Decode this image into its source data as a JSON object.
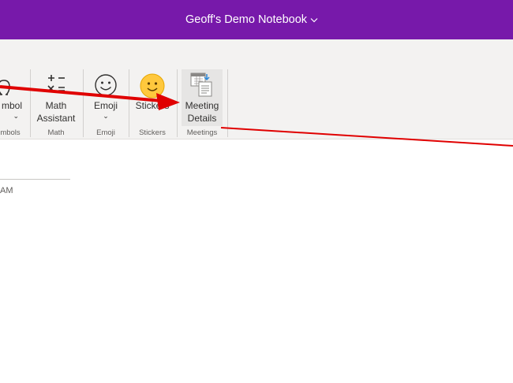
{
  "window": {
    "title": "Geoff's Demo Notebook",
    "chevron": "chevron-down-icon"
  },
  "ribbon": {
    "symbol": {
      "label": "Symbol",
      "label_visible": "mbol",
      "group": "Symbols",
      "group_visible": "mbols",
      "icon": "omega-icon"
    },
    "math": {
      "label_line1": "Math",
      "label_line2": "Assistant",
      "group": "Math",
      "icon": "math-operators-icon"
    },
    "emoji": {
      "label": "Emoji",
      "group": "Emoji",
      "icon": "smiley-icon"
    },
    "stickers": {
      "label": "Stickers",
      "group": "Stickers",
      "icon": "sticker-smiley-icon"
    },
    "meeting": {
      "label_line1": "Meeting",
      "label_line2": "Details",
      "group": "Meetings",
      "icon": "meeting-details-icon"
    }
  },
  "page": {
    "time_fragment": "AM"
  },
  "annotation_color": "#e00000"
}
